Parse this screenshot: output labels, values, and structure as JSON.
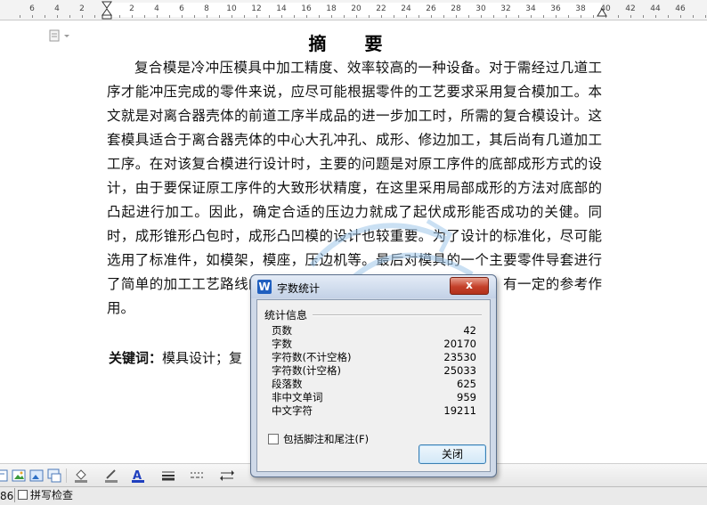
{
  "ruler": {
    "labels": [
      "6",
      "4",
      "2",
      "2",
      "4",
      "6",
      "8",
      "10",
      "12",
      "14",
      "16",
      "18",
      "20",
      "22",
      "24",
      "26",
      "28",
      "30",
      "32",
      "34",
      "36",
      "38",
      "40",
      "42",
      "44",
      "46"
    ]
  },
  "document": {
    "title": "摘  要",
    "body": "复合模是冷冲压模具中加工精度、效率较高的一种设备。对于需经过几道工序才能冲压完成的零件来说，应尽可能根据零件的工艺要求采用复合模加工。本文就是对离合器壳体的前道工序半成品的进一步加工时，所需的复合模设计。这套模具适合于离合器壳体的中心大孔冲孔、成形、修边加工，其后尚有几道加工工序。在对该复合模进行设计时，主要的问题是对原工序件的底部成形方式的设计，由于要保证原工序件的大致形状精度，在这里采用局部成形的方法对底部的凸起进行加工。因此，确定合适的压边力就成了起伏成形能否成功的关健。同时，成形锥形凸包时，成形凸凹模的设计也较重要。为了设计的标准化，尽可能选用了标准件，如模架，模座，压边机等。最后对模具的一个主要零件导套进行了简单的加工工艺路线的制定。本设计对同类零件的模具设计，有一定的参考作用。",
    "keywords_label": "关键词：",
    "keywords_text": "模具设计；复"
  },
  "statusbar": {
    "page_num": "86",
    "spell_check": "拼写检查"
  },
  "dialog": {
    "title": "字数统计",
    "close_x": "x",
    "group_label": "统计信息",
    "stats": [
      {
        "label": "页数",
        "value": "42"
      },
      {
        "label": "字数",
        "value": "20170"
      },
      {
        "label": "字符数(不计空格)",
        "value": "23530"
      },
      {
        "label": "字符数(计空格)",
        "value": "25033"
      },
      {
        "label": "段落数",
        "value": "625"
      },
      {
        "label": "非中文单词",
        "value": "959"
      },
      {
        "label": "中文字符",
        "value": "19211"
      }
    ],
    "checkbox_label": "包括脚注和尾注(F)",
    "close_button": "关闭"
  },
  "colors": {
    "dialog_frame": "#cfd9e8",
    "close_x_red": "#c4402a",
    "font_color_blue": "#1f3fbf"
  }
}
